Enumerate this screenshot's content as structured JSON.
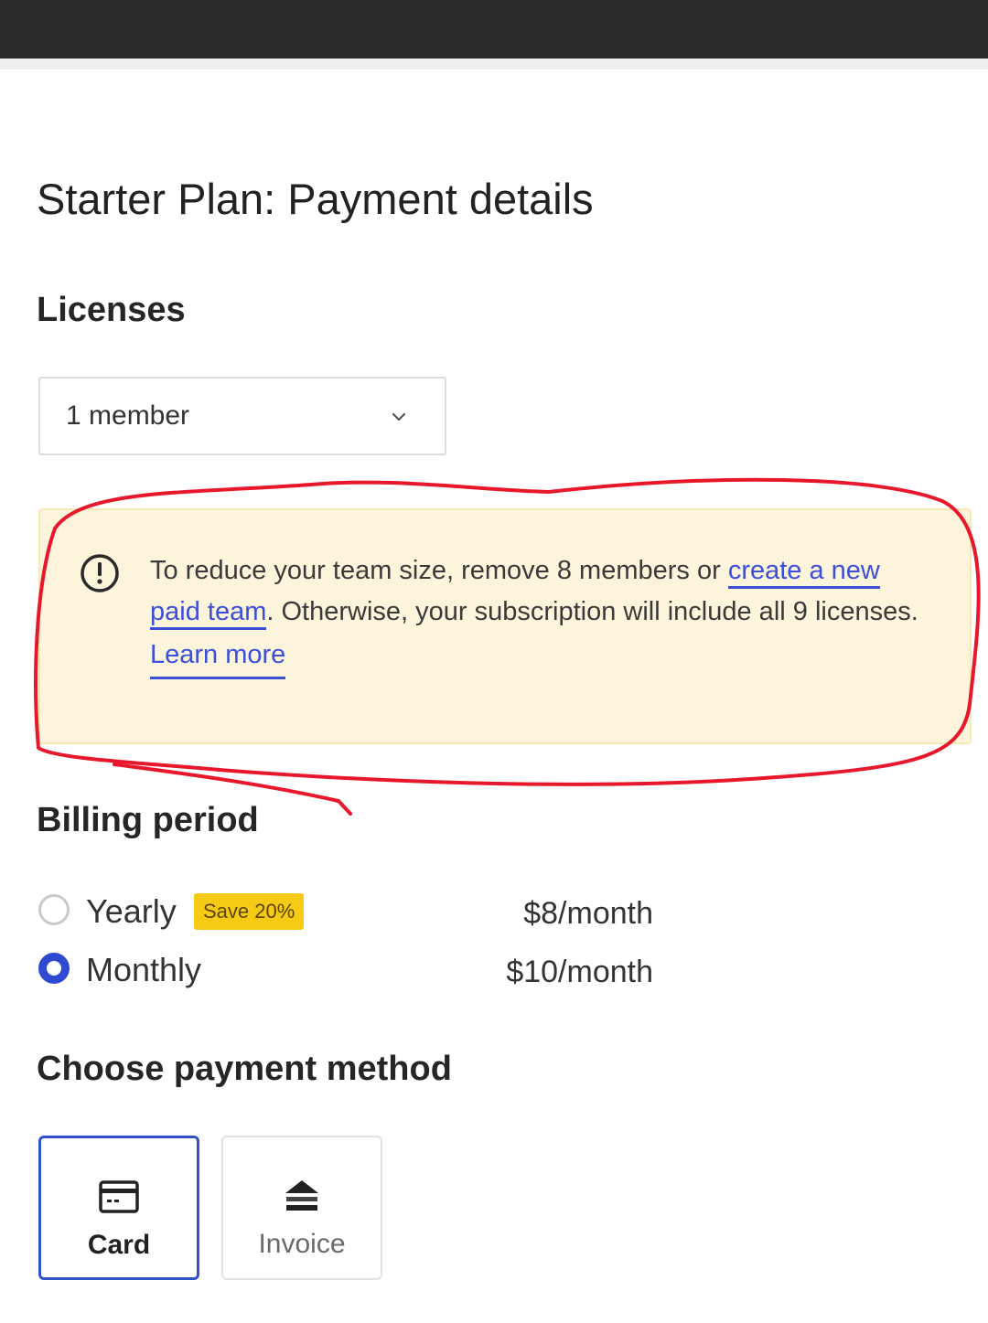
{
  "page": {
    "title": "Starter Plan: Payment details"
  },
  "licenses": {
    "heading": "Licenses",
    "selected": "1 member"
  },
  "notice": {
    "text_before": "To reduce your team size, remove 8 members or ",
    "link_create": "create a new paid team",
    "text_after": ". Otherwise, your subscription will include all 9 licenses.",
    "learn_more": "Learn more",
    "background": "#fdf4dc",
    "link_color": "#3b4fd8",
    "icon": "alert-circle-icon"
  },
  "billing": {
    "heading": "Billing period",
    "options": [
      {
        "label": "Yearly",
        "badge": "Save 20%",
        "price": "$8/month",
        "selected": false
      },
      {
        "label": "Monthly",
        "price": "$10/month",
        "selected": true
      }
    ],
    "accent": "#2f49d1",
    "badge_color": "#f7cb15"
  },
  "payment": {
    "heading": "Choose payment method",
    "methods": [
      {
        "label": "Card",
        "icon": "credit-card-icon",
        "selected": true
      },
      {
        "label": "Invoice",
        "icon": "bank-icon",
        "selected": false
      }
    ]
  },
  "annotation": {
    "color": "#e8182c",
    "shape": "hand-drawn ellipse around notice"
  }
}
